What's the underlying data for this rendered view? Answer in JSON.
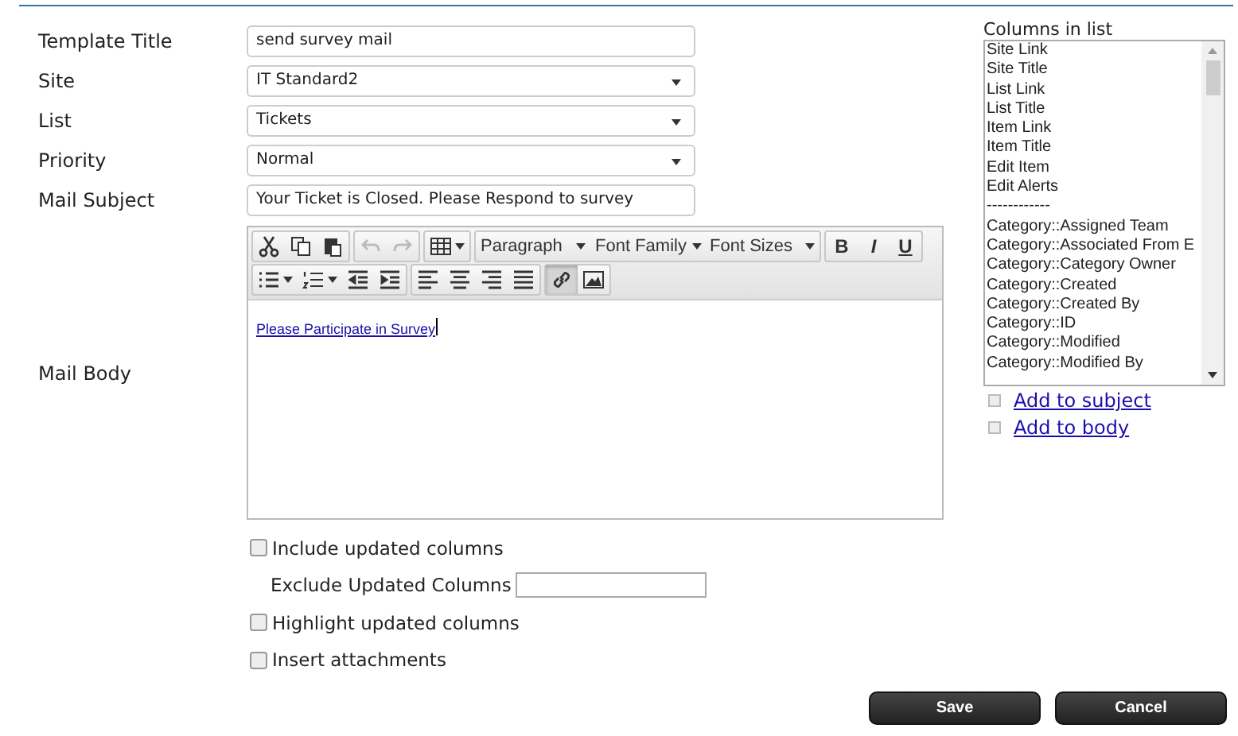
{
  "fields": [
    {
      "label": "Template Title",
      "kind": "text",
      "value": "send survey mail"
    },
    {
      "label": "Site",
      "kind": "select",
      "value": "IT Standard2"
    },
    {
      "label": "List",
      "kind": "select",
      "value": "Tickets"
    },
    {
      "label": "Priority",
      "kind": "select",
      "value": "Normal"
    },
    {
      "label": "Mail Subject",
      "kind": "text",
      "value": "Your Ticket is Closed. Please Respond to survey"
    }
  ],
  "mail_body": {
    "label": "Mail Body",
    "link_text": "Please Participate in Survey",
    "toolbar": [
      [
        [
          {
            "kind": "icon",
            "disabled": false,
            "pressed": false
          },
          {
            "kind": "icon",
            "disabled": false,
            "pressed": false
          },
          {
            "kind": "icon",
            "disabled": false,
            "pressed": false
          }
        ],
        [
          {
            "kind": "icon",
            "disabled": true,
            "pressed": false
          },
          {
            "kind": "icon",
            "disabled": true,
            "pressed": false
          }
        ],
        [
          {
            "kind": "icon_menu",
            "disabled": false,
            "pressed": false
          }
        ],
        [
          {
            "kind": "dropdown",
            "label": "Paragraph"
          },
          {
            "kind": "dropdown",
            "label": "Font Family"
          },
          {
            "kind": "dropdown",
            "label": "Font Sizes"
          }
        ],
        [
          {
            "kind": "letter",
            "label": "B"
          },
          {
            "kind": "letter",
            "label": "I"
          },
          {
            "kind": "letter",
            "label": "U"
          }
        ]
      ],
      [
        [
          {
            "kind": "icon_menu",
            "disabled": false,
            "pressed": false
          },
          {
            "kind": "icon_menu",
            "disabled": false,
            "pressed": false
          },
          {
            "kind": "icon",
            "disabled": false,
            "pressed": false
          },
          {
            "kind": "icon",
            "disabled": false,
            "pressed": false
          }
        ],
        [
          {
            "kind": "icon",
            "disabled": false,
            "pressed": false
          },
          {
            "kind": "icon",
            "disabled": false,
            "pressed": false
          },
          {
            "kind": "icon",
            "disabled": false,
            "pressed": false
          },
          {
            "kind": "icon",
            "disabled": false,
            "pressed": false
          }
        ],
        [
          {
            "kind": "icon",
            "disabled": false,
            "pressed": true
          },
          {
            "kind": "icon",
            "disabled": false,
            "pressed": false
          }
        ]
      ]
    ]
  },
  "options": [
    {
      "kind": "checkbox",
      "label": "Include updated columns",
      "checked": false
    },
    {
      "kind": "text_input",
      "label": "Exclude Updated Columns"
    },
    {
      "kind": "checkbox",
      "label": "Highlight updated columns",
      "checked": false
    },
    {
      "kind": "checkbox",
      "label": "Insert attachments",
      "checked": false
    }
  ],
  "columns_panel": {
    "title": "Columns in list",
    "items": [
      "Site Link",
      "Site Title",
      "List Link",
      "List Title",
      "Item Link",
      "Item Title",
      "Edit Item",
      "Edit Alerts",
      "------------",
      "Category::Assigned Team",
      "Category::Associated From E",
      "Category::Category Owner",
      "Category::Created",
      "Category::Created By",
      "Category::ID",
      "Category::Modified",
      "Category::Modified By"
    ],
    "links": [
      "Add to subject",
      "Add to body"
    ]
  },
  "buttons": [
    "Save",
    "Cancel"
  ]
}
